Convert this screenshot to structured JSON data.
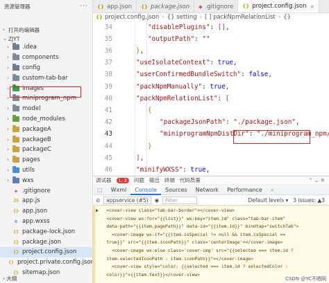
{
  "sidebar": {
    "title": "资源管理器",
    "more_icon": "more-icon",
    "open_editors": "打开的编辑器",
    "project": "ZJYT",
    "outline": "大纲",
    "items": [
      {
        "label": ".idea",
        "kind": "folder",
        "icon": "folder-icon"
      },
      {
        "label": "components",
        "kind": "folder",
        "icon": "folder-icon"
      },
      {
        "label": "config",
        "kind": "folder",
        "icon": "folder-icon"
      },
      {
        "label": "custom-tab-bar",
        "kind": "folder",
        "icon": "folder-icon"
      },
      {
        "label": "images",
        "kind": "folder",
        "icon": "images-folder-icon"
      },
      {
        "label": "miniprogram_npm",
        "kind": "folder",
        "icon": "folder-icon"
      },
      {
        "label": "model",
        "kind": "folder",
        "icon": "folder-icon"
      },
      {
        "label": "node_modules",
        "kind": "folder",
        "icon": "node-modules-folder-icon"
      },
      {
        "label": "packageA",
        "kind": "folder",
        "icon": "package-folder-icon"
      },
      {
        "label": "packageB",
        "kind": "folder",
        "icon": "package-folder-icon"
      },
      {
        "label": "packageC",
        "kind": "folder",
        "icon": "package-folder-icon"
      },
      {
        "label": "pages",
        "kind": "folder",
        "icon": "pages-folder-icon"
      },
      {
        "label": "utils",
        "kind": "folder",
        "icon": "utils-folder-icon"
      },
      {
        "label": "wxs",
        "kind": "folder",
        "icon": "wxs-folder-icon"
      },
      {
        "label": ".gitignore",
        "kind": "git",
        "icon": "git-file-icon"
      },
      {
        "label": "app.js",
        "kind": "js",
        "icon": "js-file-icon"
      },
      {
        "label": "app.json",
        "kind": "json",
        "icon": "json-file-icon"
      },
      {
        "label": "app.wxss",
        "kind": "wxss",
        "icon": "wxss-file-icon"
      },
      {
        "label": "package-lock.json",
        "kind": "json",
        "icon": "json-file-icon"
      },
      {
        "label": "package.json",
        "kind": "json",
        "icon": "json-file-icon"
      },
      {
        "label": "project.config.json",
        "kind": "json",
        "icon": "json-file-icon",
        "selected": true
      },
      {
        "label": "project.private.config.json",
        "kind": "json",
        "icon": "json-file-icon"
      },
      {
        "label": "sitemap.json",
        "kind": "json",
        "icon": "json-file-icon"
      }
    ]
  },
  "tabs": [
    {
      "label": "app.json",
      "icon": "json-file-icon",
      "italic": false
    },
    {
      "label": "package.json",
      "icon": "json-file-icon",
      "italic": true
    },
    {
      "label": ".gitignore",
      "icon": "git-file-icon",
      "italic": false
    },
    {
      "label": "project.config.json",
      "icon": "json-file-icon",
      "italic": false,
      "active": true
    }
  ],
  "breadcrumb": [
    "project.config.json",
    "{} setting",
    "[ ] packNpmRelationList",
    "{}"
  ],
  "editor": {
    "lines": [
      {
        "n": "34",
        "tokens": [
          [
            "s",
            "\"disablePlugins\""
          ],
          [
            "p",
            ": "
          ],
          [
            "brk",
            "[]"
          ],
          [
            "p",
            ","
          ]
        ],
        "indent": 1
      },
      {
        "n": "35",
        "tokens": [
          [
            "s",
            "\"outputPath\""
          ],
          [
            "p",
            ": "
          ],
          [
            "s",
            "\"\""
          ]
        ],
        "indent": 1
      },
      {
        "n": "36",
        "tokens": [
          [
            "brc",
            "}"
          ],
          [
            "p",
            ","
          ]
        ],
        "indent": 0
      },
      {
        "n": "37",
        "tokens": [
          [
            "s",
            "\"useIsolateContext\""
          ],
          [
            "p",
            ": "
          ],
          [
            "kw",
            "true"
          ],
          [
            "p",
            ","
          ]
        ],
        "indent": 0
      },
      {
        "n": "38",
        "tokens": [
          [
            "s",
            "\"userConfirmedBundleSwitch\""
          ],
          [
            "p",
            ": "
          ],
          [
            "kw",
            "false"
          ],
          [
            "p",
            ","
          ]
        ],
        "indent": 0
      },
      {
        "n": "39",
        "tokens": [
          [
            "s",
            "\"packNpmManually\""
          ],
          [
            "p",
            ": "
          ],
          [
            "kw",
            "true"
          ],
          [
            "p",
            ","
          ]
        ],
        "indent": 0
      },
      {
        "n": "40",
        "tokens": [
          [
            "s",
            "\"packNpmRelationList\""
          ],
          [
            "p",
            ": "
          ],
          [
            "brk",
            "["
          ]
        ],
        "indent": 0
      },
      {
        "n": "41",
        "tokens": [
          [
            "brc",
            "{"
          ]
        ],
        "indent": 1
      },
      {
        "n": "42",
        "tokens": [
          [
            "s",
            "\"packageJsonPath\""
          ],
          [
            "p",
            ": "
          ],
          [
            "s",
            "\"./package.json\""
          ],
          [
            "p",
            ","
          ]
        ],
        "indent": 2
      },
      {
        "n": "43",
        "tokens": [
          [
            "s",
            "\"miniprogramNpmDistDir\""
          ],
          [
            "p",
            ": "
          ],
          [
            "s",
            "\"./miniprogram_npm/\""
          ]
        ],
        "indent": 2
      },
      {
        "n": "44",
        "tokens": [
          [
            "brc",
            "}"
          ]
        ],
        "indent": 1
      },
      {
        "n": "45",
        "tokens": [
          [
            "brk",
            "]"
          ],
          [
            "p",
            ","
          ]
        ],
        "indent": 0
      },
      {
        "n": "46",
        "tokens": [
          [
            "s",
            "\"minifyWXSS\""
          ],
          [
            "p",
            ": "
          ],
          [
            "kw",
            "true"
          ],
          [
            "p",
            ","
          ]
        ],
        "indent": 0
      }
    ],
    "current_line": "43"
  },
  "debug": {
    "title": "调试器",
    "badge": "1, 2",
    "items": [
      "问题",
      "输出",
      "终端",
      "代码质量"
    ],
    "tabs": [
      "Wxml",
      "Console",
      "Sources",
      "Network",
      "Performance"
    ],
    "active_tab": "Console",
    "context": "appservice (#5)",
    "filter_placeholder": "Filter",
    "levels": "Default levels ▾",
    "issues": "3 issues: ▲3",
    "log": [
      "▶   <cover-view class=\"tab-bar-border\"></cover-view>",
      "    <cover-view wx:for=\"{{list}}\" wx:key=\"item.id\" class=\"tab-bar-item\"",
      "    data-path=\"{{item.pagePath}}\" data-id=\"{{item.id}}\" bindtap=\"switchTab\">",
      "      <cover-image wx:if=\"{{item.isSpecial != null && item.isSpecial ==",
      "    true}}\" src=\"{{item.iconPath}}\" class='centerImage'></cover-image>",
      "      <cover-image wx:else class='cover-img' src=\"{{selected === item.id ?",
      "    item.selectedIconPath : item.iconPath}}\"></cover-image>",
      "      <cover-view style=\"color: {{selected === item.id ? selectedColor :",
      "    color}}\">{{item.text}}</cover-view>"
    ],
    "watermark": "CSDN @YC不晒网"
  }
}
